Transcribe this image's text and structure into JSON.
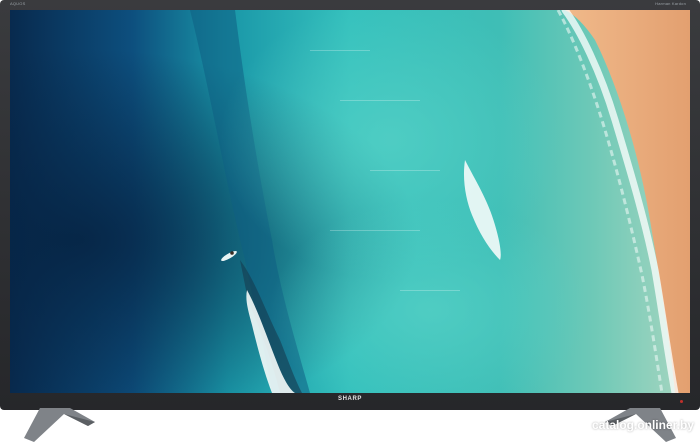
{
  "tv": {
    "brand": "SHARP",
    "corner_left_text": "AQUOS",
    "corner_right_text": "Harman Kardon"
  },
  "watermark": "catalog.onliner.by",
  "colors": {
    "bezel": "#2e2f32",
    "deep_water": "#0b3f6b",
    "turquoise": "#2bb3b5",
    "sand": "#e9b07e",
    "led": "#c0302b"
  }
}
